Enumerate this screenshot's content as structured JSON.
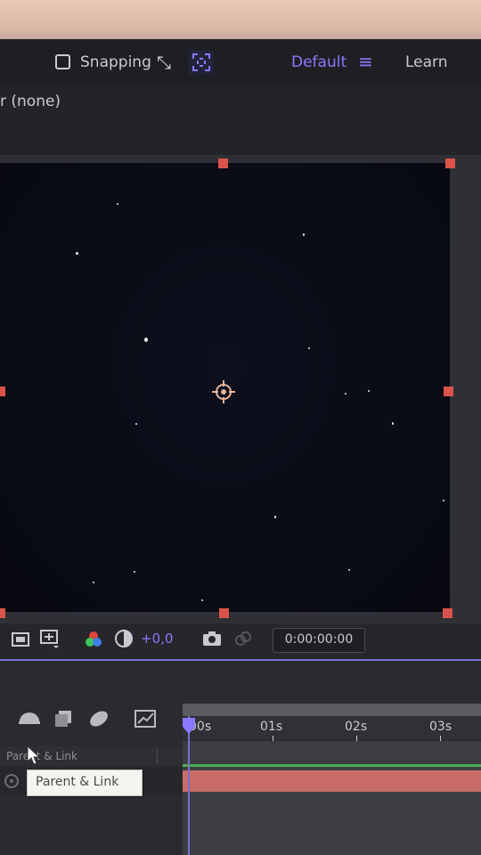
{
  "toolbar": {
    "snapping_label": "Snapping",
    "workspace_label": "Default",
    "menu_glyph": "≡",
    "learn_label": "Learn",
    "arrow_glyph": "⤡"
  },
  "layer_bar": {
    "label": "r (none)"
  },
  "viewer_controls": {
    "exposure_value": "+0,0",
    "timecode": "0:00:00:00"
  },
  "timeline": {
    "ticks": [
      "00s",
      "01s",
      "02s",
      "03s"
    ],
    "column_header": "Parent & Link",
    "tooltip": "Parent & Link"
  },
  "colors": {
    "accent": "#8a78ff",
    "handle": "#d9534a",
    "track_bar": "#c96b66",
    "track_green": "#4caf50"
  }
}
